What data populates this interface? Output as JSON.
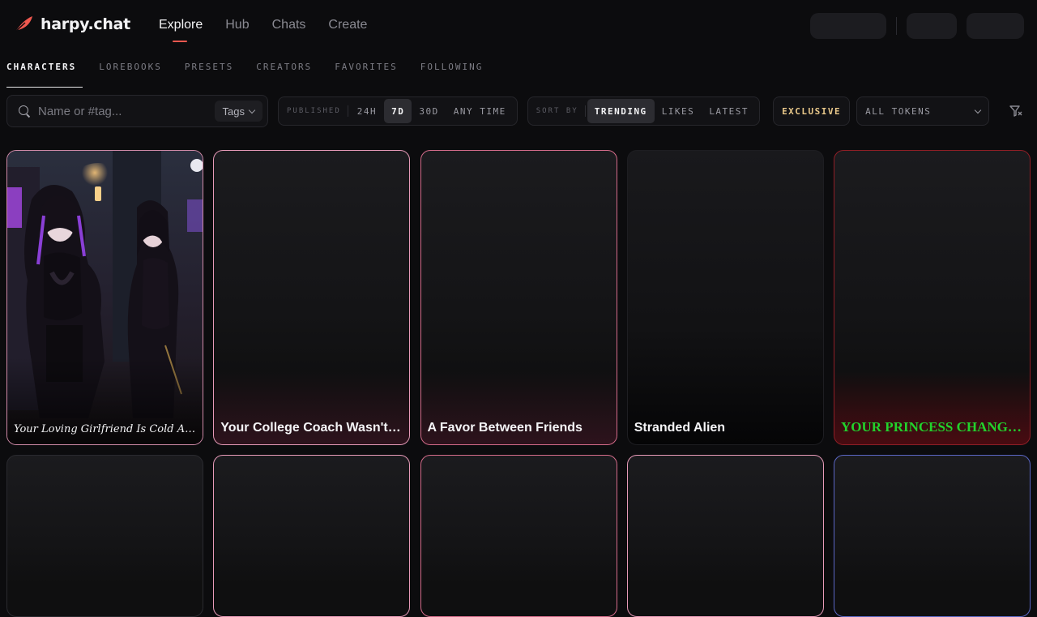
{
  "app": {
    "name": "harpy.chat"
  },
  "nav": {
    "items": [
      "Explore",
      "Hub",
      "Chats",
      "Create"
    ],
    "active": "Explore"
  },
  "subtabs": {
    "items": [
      "CHARACTERS",
      "LOREBOOKS",
      "PRESETS",
      "CREATORS",
      "FAVORITES",
      "FOLLOWING"
    ],
    "active": "CHARACTERS"
  },
  "search": {
    "placeholder": "Name or #tag...",
    "tags_label": "Tags"
  },
  "published": {
    "label": "PUBLISHED",
    "options": [
      "24H",
      "7D",
      "30D",
      "ANY TIME"
    ],
    "active": "7D"
  },
  "sort": {
    "label": "SORT BY",
    "options": [
      "TRENDING",
      "LIKES",
      "LATEST"
    ],
    "active": "TRENDING"
  },
  "exclusive_label": "EXCLUSIVE",
  "tokens_label": "ALL TOKENS",
  "colors": {
    "accent": "#f0584f",
    "exclusive": "#e9c88a",
    "green_title": "#22d32c"
  },
  "cards": [
    {
      "title": "Your Loving Girlfriend Is Cold Around You Now"
    },
    {
      "title": "Your College Coach Wasn't Supposed to See This"
    },
    {
      "title": "A Favor Between Friends"
    },
    {
      "title": "Stranded Alien"
    },
    {
      "title": "YOUR PRINCESS CHANGED - She Forgot You"
    },
    {
      "title": ""
    },
    {
      "title": ""
    },
    {
      "title": ""
    },
    {
      "title": ""
    },
    {
      "title": ""
    }
  ]
}
